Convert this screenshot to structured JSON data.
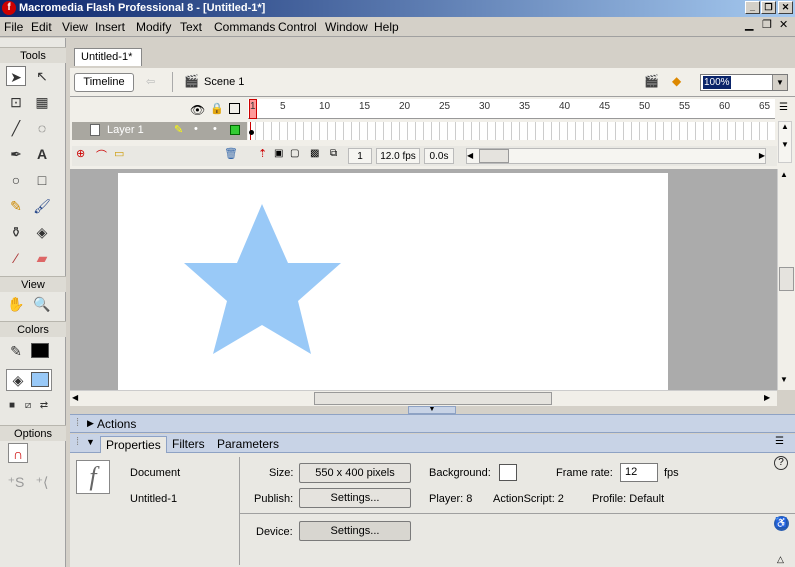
{
  "window": {
    "title": "Macromedia Flash Professional 8 - [Untitled-1*]",
    "app_icon_glyph": "f"
  },
  "menu": [
    "File",
    "Edit",
    "View",
    "Insert",
    "Modify",
    "Text",
    "Commands",
    "Control",
    "Window",
    "Help"
  ],
  "toolbox": {
    "tools_label": "Tools",
    "view_label": "View",
    "colors_label": "Colors",
    "options_label": "Options"
  },
  "document": {
    "tab": "Untitled-1*",
    "timeline_button": "Timeline",
    "scene": "Scene 1",
    "zoom": "100%"
  },
  "timeline": {
    "ticks": [
      "1",
      "5",
      "10",
      "15",
      "20",
      "25",
      "30",
      "35",
      "40",
      "45",
      "50",
      "55",
      "60",
      "65"
    ],
    "layer": "Layer 1",
    "current_frame": "1",
    "fps": "12.0 fps",
    "elapsed": "0.0s"
  },
  "stage": {
    "shape": "star",
    "star_color": "#99c9f7",
    "background": "#ffffff"
  },
  "panels": {
    "actions": "Actions",
    "tabs": [
      "Properties",
      "Filters",
      "Parameters"
    ],
    "doc_type": "Document",
    "doc_name": "Untitled-1",
    "size_label": "Size:",
    "size_value": "550 x 400 pixels",
    "background_label": "Background:",
    "frame_rate_label": "Frame rate:",
    "frame_rate_value": "12",
    "frame_rate_unit": "fps",
    "publish_label": "Publish:",
    "settings_label": "Settings...",
    "player": "Player: 8",
    "actionscript": "ActionScript:  2",
    "profile": "Profile:  Default",
    "device_label": "Device:",
    "device_settings": "Settings..."
  },
  "colors": {
    "accent": "#0a246a",
    "panel_header": "#c8d3e6",
    "stroke_color": "#000000",
    "fill_color": "#99c9f7"
  }
}
